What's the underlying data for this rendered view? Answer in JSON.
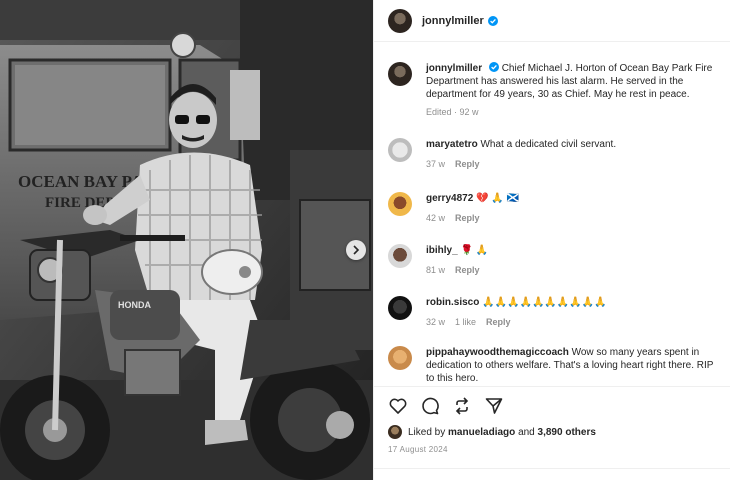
{
  "post": {
    "username": "jonnylmiller",
    "caption": "Chief Michael J. Horton of Ocean Bay Park Fire Department has answered his last alarm. He served in the department for 49 years, 30 as Chief. May he rest in peace.",
    "caption_meta": "Edited · 92 w",
    "photo_sign": "OCEAN BAY PARK FIRE DEPT",
    "photo_bike_badge": "HONDA"
  },
  "comments": [
    {
      "user": "maryatetro",
      "text": "What a dedicated civil servant.",
      "age": "37 w",
      "likes": "",
      "reply": "Reply"
    },
    {
      "user": "gerry4872",
      "text": "💔 🙏 🏴󠁧󠁢󠁳󠁣󠁴󠁿",
      "age": "42 w",
      "likes": "",
      "reply": "Reply"
    },
    {
      "user": "ibihly_",
      "text": "🌹 🙏",
      "age": "81 w",
      "likes": "",
      "reply": "Reply"
    },
    {
      "user": "robin.sisco",
      "text": "🙏🙏🙏🙏🙏🙏🙏🙏🙏🙏",
      "age": "32 w",
      "likes": "1 like",
      "reply": "Reply"
    },
    {
      "user": "pippahaywoodthemagiccoach",
      "text": "Wow so many years spent in dedication to others welfare. That's a loving heart right there. RIP to this hero.",
      "age": "",
      "likes": "",
      "reply": ""
    }
  ],
  "likes": {
    "prefix": "Liked by",
    "user": "manueladiago",
    "and": "and",
    "count": "3,890 others"
  },
  "date": "17 August 2024",
  "icons": {
    "like": "heart-icon",
    "comment": "comment-icon",
    "share": "repost-icon",
    "send": "send-icon"
  },
  "colors": {
    "verified": "#0095f6",
    "muted": "#8e8e8e",
    "text": "#262626"
  }
}
